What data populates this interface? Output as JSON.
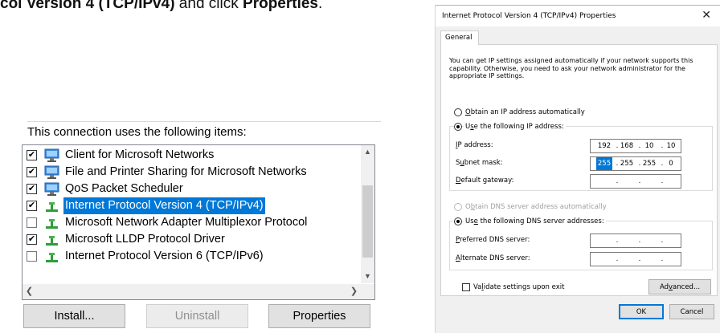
{
  "instruction": {
    "prefix": "col Version 4 (TCP/IPv4)",
    "middle": " and click ",
    "action": "Properties",
    "suffix": "."
  },
  "left_panel": {
    "heading": "This connection uses the following items:",
    "items": [
      {
        "label": "Client for Microsoft Networks",
        "checked": true,
        "icon": "network-client-icon"
      },
      {
        "label": "File and Printer Sharing for Microsoft Networks",
        "checked": true,
        "icon": "file-sharing-icon"
      },
      {
        "label": "QoS Packet Scheduler",
        "checked": true,
        "icon": "network-service-icon"
      },
      {
        "label": "Internet Protocol Version 4 (TCP/IPv4)",
        "checked": true,
        "selected": true,
        "icon": "protocol-icon"
      },
      {
        "label": "Microsoft Network Adapter Multiplexor Protocol",
        "checked": false,
        "icon": "protocol-icon"
      },
      {
        "label": "Microsoft LLDP Protocol Driver",
        "checked": true,
        "icon": "protocol-icon"
      },
      {
        "label": "Internet Protocol Version 6 (TCP/IPv6)",
        "checked": false,
        "icon": "protocol-icon"
      }
    ],
    "buttons": {
      "install": "Install...",
      "uninstall": "Uninstall",
      "properties": "Properties"
    }
  },
  "dialog": {
    "title": "Internet Protocol Version 4 (TCP/IPv4) Properties",
    "tab": "General",
    "description": "You can get IP settings assigned automatically if your network supports this capability. Otherwise, you need to ask your network administrator for the appropriate IP settings.",
    "ip_auto": {
      "u": "O",
      "rest": "btain an IP address automatically",
      "selected": false
    },
    "ip_manual": {
      "pre": "U",
      "u": "s",
      "rest": "e the following IP address:",
      "selected": true
    },
    "ip_address": {
      "u": "I",
      "rest": "P address:",
      "octets": [
        "192",
        "168",
        "10",
        "10"
      ]
    },
    "subnet_mask": {
      "pre": "S",
      "u": "u",
      "rest": "bnet mask:",
      "octets": [
        "255",
        "255",
        "255",
        "0"
      ]
    },
    "default_gateway": {
      "u": "D",
      "rest": "efault gateway:",
      "octets": [
        "",
        "",
        "",
        ""
      ]
    },
    "dns_auto": {
      "pre": "O",
      "u": "b",
      "rest": "tain DNS server address automatically",
      "selected": false
    },
    "dns_manual": {
      "pre": "Us",
      "u": "e",
      "rest": " the following DNS server addresses:",
      "selected": true
    },
    "preferred_dns": {
      "u": "P",
      "rest": "referred DNS server:",
      "octets": [
        "",
        "",
        "",
        ""
      ]
    },
    "alternate_dns": {
      "u": "A",
      "rest": "lternate DNS server:",
      "octets": [
        "",
        "",
        "",
        ""
      ]
    },
    "validate": {
      "pre": "Va",
      "u": "l",
      "rest": "idate settings upon exit",
      "checked": false
    },
    "advanced": {
      "pre": "Ad",
      "u": "v",
      "rest": "anced..."
    },
    "ok": "OK",
    "cancel": "Cancel"
  }
}
